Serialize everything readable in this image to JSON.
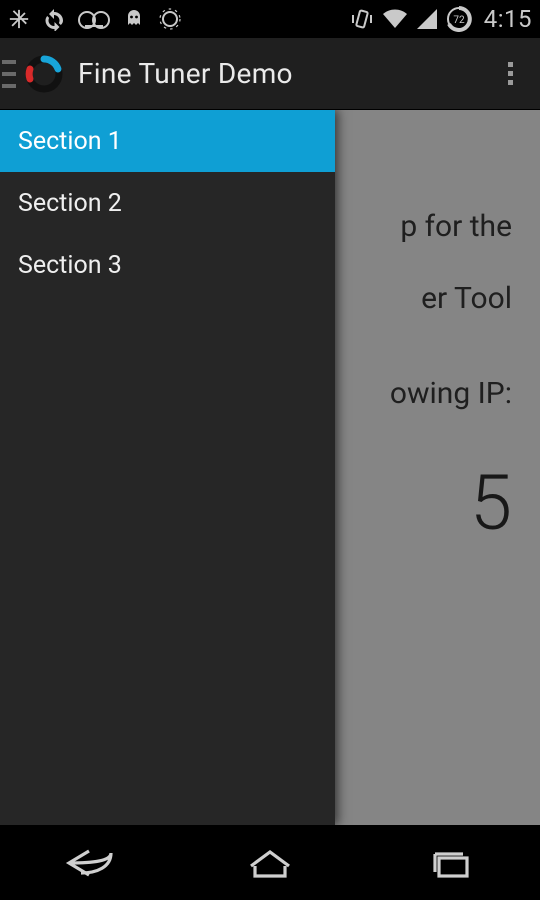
{
  "status": {
    "clock": "4:15",
    "battery_text": "72"
  },
  "actionbar": {
    "title": "Fine Tuner Demo"
  },
  "drawer": {
    "items": [
      {
        "label": "Section 1",
        "selected": true
      },
      {
        "label": "Section 2",
        "selected": false
      },
      {
        "label": "Section 3",
        "selected": false
      }
    ]
  },
  "content": {
    "line1_right": "p for the",
    "line2_right": "er Tool",
    "line3_right": "owing IP:",
    "ip_right": "5"
  }
}
